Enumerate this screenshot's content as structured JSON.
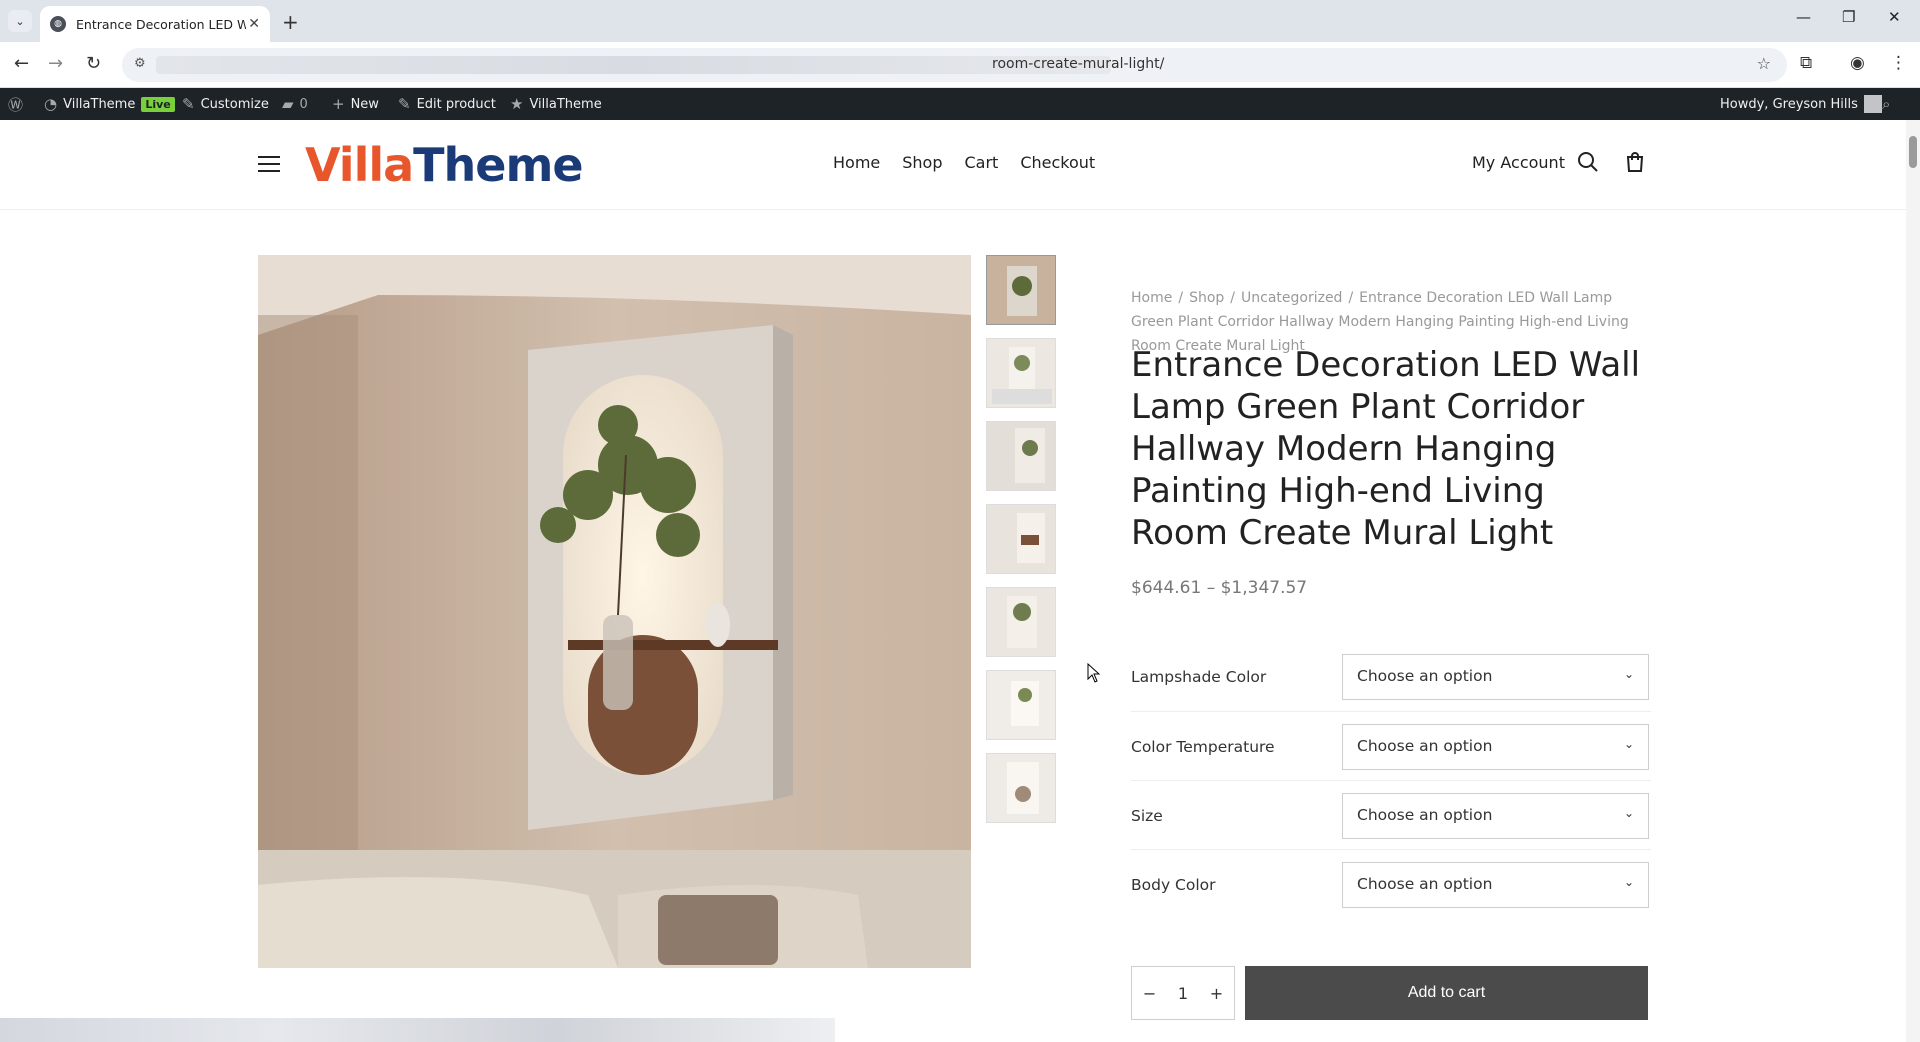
{
  "browser": {
    "tab_title": "Entrance Decoration LED Wall Lamp Green Plant Corridor",
    "url": "room-create-mural-light/",
    "icons": [
      "tab-list-icon",
      "close-icon",
      "new-tab-icon",
      "minimize-icon",
      "restore-icon",
      "window-close-icon",
      "back-icon",
      "forward-icon",
      "reload-icon",
      "site-info-icon",
      "star-icon",
      "extensions-icon",
      "profile-icon",
      "menu-icon"
    ]
  },
  "adminbar": {
    "site_name": "VillaTheme",
    "live_badge": "Live",
    "customize": "Customize",
    "comments_count": "0",
    "new": "New",
    "edit_product": "Edit product",
    "villatheme": "VillaTheme",
    "howdy": "Howdy, Greyson Hills"
  },
  "header": {
    "logo_v": "V",
    "logo_rest_orange": "illa",
    "logo_rest_blue": "Theme",
    "nav": [
      "Home",
      "Shop",
      "Cart",
      "Checkout"
    ],
    "account": "My Account"
  },
  "product": {
    "breadcrumb": [
      "Home",
      "Shop",
      "Uncategorized",
      "Entrance Decoration LED Wall Lamp Green Plant Corridor Hallway Modern Hanging Painting High-end Living Room Create Mural Light"
    ],
    "title": "Entrance Decoration LED Wall Lamp Green Plant Corridor Hallway Modern Hanging Painting High-end Living Room Create Mural Light",
    "price": "$644.61 – $1,347.57",
    "variations": [
      {
        "label": "Lampshade Color",
        "value": "Choose an option"
      },
      {
        "label": "Color Temperature",
        "value": "Choose an option"
      },
      {
        "label": "Size",
        "value": "Choose an option"
      },
      {
        "label": "Body Color",
        "value": "Choose an option"
      }
    ],
    "quantity": "1",
    "qty_minus": "−",
    "qty_plus": "+",
    "add_to_cart": "Add to cart"
  }
}
